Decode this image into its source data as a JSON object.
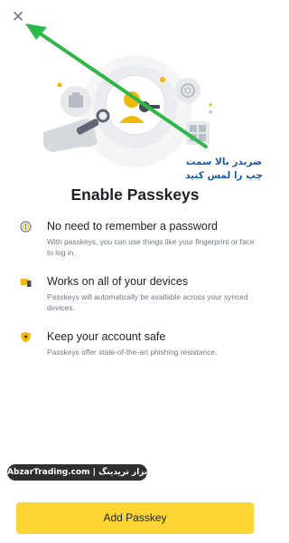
{
  "header": {
    "close_icon": "close-icon"
  },
  "hero": {
    "illustration": "passkey-illustration"
  },
  "annotation": {
    "text": "ضربدر بالا سمت چپ را لمس کنید",
    "arrow_color": "#2db84a"
  },
  "title": "Enable Passkeys",
  "features": [
    {
      "icon": "fingerprint-icon",
      "heading": "No need to remember a password",
      "description": "With passkeys, you can use things like your fingerprint or face to log in."
    },
    {
      "icon": "devices-icon",
      "heading": "Works on all of your devices",
      "description": "Passkeys will automatically be available across your synced devices."
    },
    {
      "icon": "shield-icon",
      "heading": "Keep your account safe",
      "description": "Passkeys offer state-of-the-art phishing resistance."
    }
  ],
  "watermark": "AbzarTrading.com | ابزار تریدینگ",
  "primary_button": {
    "label": "Add Passkey"
  },
  "colors": {
    "accent": "#fcd535",
    "text_primary": "#1e2329",
    "text_secondary": "#707a8a",
    "annotation_text": "#1a5aa8"
  }
}
